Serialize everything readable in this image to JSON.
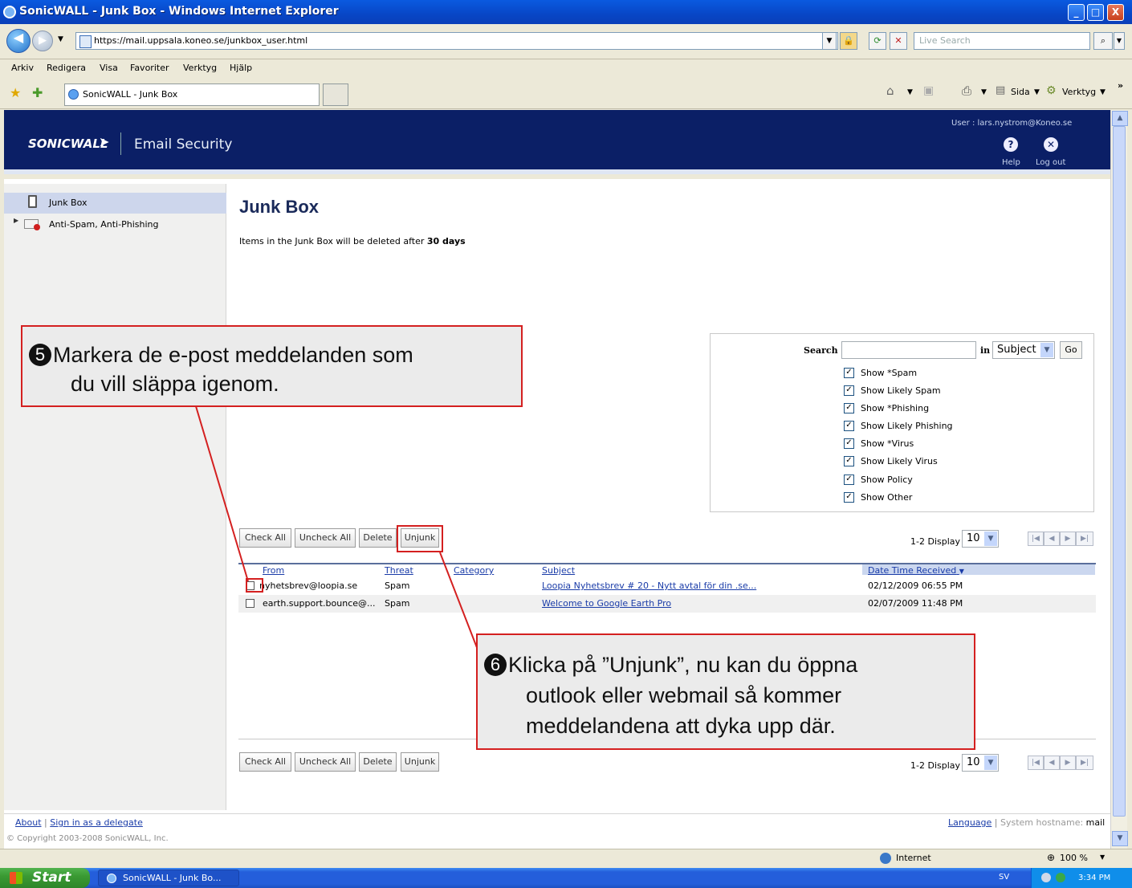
{
  "window": {
    "title": "SonicWALL - Junk Box - Windows Internet Explorer",
    "min": "_",
    "max": "□",
    "close": "X"
  },
  "address": {
    "url": "https://mail.uppsala.koneo.se/junkbox_user.html",
    "live_search_placeholder": "Live Search"
  },
  "menu": [
    "Arkiv",
    "Redigera",
    "Visa",
    "Favoriter",
    "Verktyg",
    "Hjälp"
  ],
  "tab": {
    "label": "SonicWALL - Junk Box"
  },
  "toolbar": {
    "page": "Sida",
    "tools": "Verktyg",
    "more": "»"
  },
  "header": {
    "logo": "SONICWALL",
    "product": "Email Security",
    "user": "User : lars.nystrom@Koneo.se",
    "help": "Help",
    "logout": "Log out"
  },
  "sidebar": {
    "items": [
      {
        "label": "Junk Box"
      },
      {
        "label": "Anti-Spam, Anti-Phishing"
      }
    ]
  },
  "main": {
    "title": "Junk Box",
    "retention_text": "Items in the Junk Box will be deleted after",
    "retention_value": "30 days"
  },
  "search": {
    "label": "Search",
    "in_label": "in",
    "field_value": "Subject",
    "go": "Go",
    "filters": [
      "Show *Spam",
      "Show Likely Spam",
      "Show *Phishing",
      "Show Likely Phishing",
      "Show *Virus",
      "Show Likely Virus",
      "Show Policy",
      "Show Other"
    ]
  },
  "actions": {
    "check_all": "Check All",
    "uncheck_all": "Uncheck All",
    "delete": "Delete",
    "unjunk": "Unjunk"
  },
  "pagination": {
    "range": "1-2",
    "display_label": "Display",
    "per_page": "10"
  },
  "table": {
    "columns": [
      "From",
      "Threat",
      "Category",
      "Subject",
      "Date Time Received"
    ],
    "rows": [
      {
        "from": "nyhetsbrev@loopia.se",
        "threat": "Spam",
        "category": "",
        "subject": "Loopia Nyhetsbrev # 20 - Nytt avtal för din .se...",
        "date": "02/12/2009 06:55 PM"
      },
      {
        "from": "earth.support.bounce@...",
        "threat": "Spam",
        "category": "",
        "subject": "Welcome to Google Earth Pro",
        "date": "02/07/2009 11:48 PM"
      }
    ]
  },
  "footer": {
    "about": "About",
    "delegate": "Sign in as a delegate",
    "language": "Language",
    "hostname_label": "System hostname:",
    "hostname": "mail",
    "copyright": "© Copyright 2003-2008 SonicWALL, Inc."
  },
  "statusbar": {
    "zone": "Internet",
    "zoom": "100 %"
  },
  "taskbar": {
    "start": "Start",
    "item": "SonicWALL - Junk Bo...",
    "lang": "SV",
    "time": "3:34 PM"
  },
  "annotations": {
    "step5": {
      "number": "5",
      "line1": "Markera de e-post meddelanden som",
      "line2": "du vill släppa igenom."
    },
    "step6": {
      "number": "6",
      "line1": "Klicka på ”Unjunk”, nu kan du öppna",
      "line2": "outlook eller webmail så kommer",
      "line3": "meddelandena att dyka upp där."
    }
  },
  "colors": {
    "header_bg": "#0b1f66",
    "link": "#1a3ca8",
    "annotation_red": "#d42020",
    "sidebar_selected": "#cdd6ec"
  },
  "icons": [
    "ie-icon",
    "back-icon",
    "forward-icon",
    "page-icon",
    "lock-icon",
    "refresh-icon",
    "stop-icon",
    "search-icon",
    "favorites-star-icon",
    "add-favorites-icon",
    "home-icon",
    "feeds-icon",
    "print-icon",
    "page-menu-icon",
    "tools-icon",
    "help-icon",
    "logout-icon",
    "junkbox-icon",
    "antispam-icon",
    "globe-icon",
    "zoom-icon",
    "windows-flag-icon"
  ]
}
